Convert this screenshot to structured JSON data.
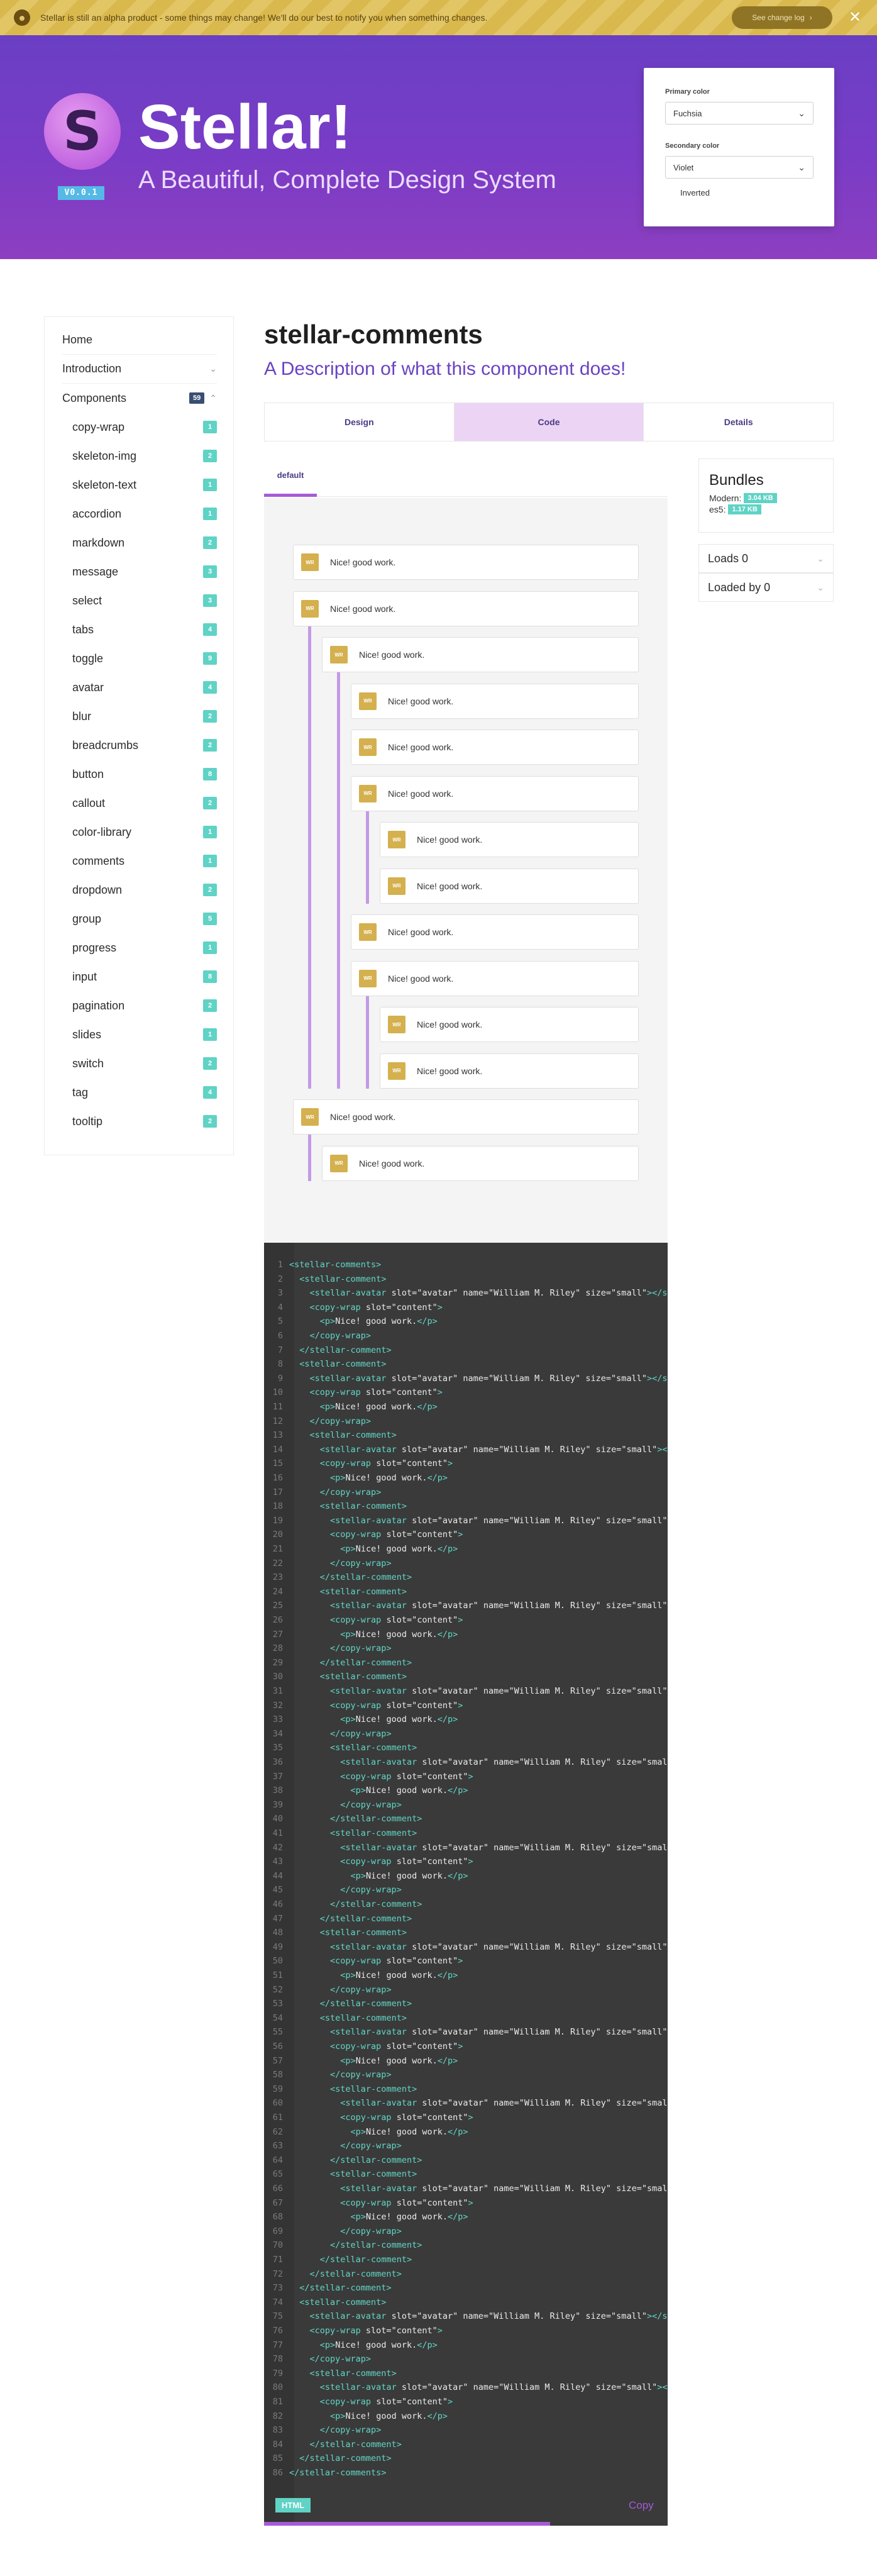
{
  "banner": {
    "logo_glyph": "☻",
    "message": "Stellar is still an alpha product - some things may change! We'll do our best to notify you when something changes.",
    "changelog_label": "See change log",
    "changelog_icon": "chevron-right-icon",
    "close_glyph": "✕"
  },
  "hero": {
    "logo_letter": "S",
    "version": "V0.0.1",
    "title": "Stellar!",
    "subtitle": "A Beautiful, Complete Design System"
  },
  "settings": {
    "primary_label": "Primary color",
    "primary_value": "Fuchsia",
    "secondary_label": "Secondary color",
    "secondary_value": "Violet",
    "inverted_label": "Inverted",
    "inverted_checked": false
  },
  "sidebar": {
    "home": "Home",
    "introduction": "Introduction",
    "components": "Components",
    "components_count": "59",
    "items": [
      {
        "label": "copy-wrap",
        "badge": "1"
      },
      {
        "label": "skeleton-img",
        "badge": "2"
      },
      {
        "label": "skeleton-text",
        "badge": "1"
      },
      {
        "label": "accordion",
        "badge": "1"
      },
      {
        "label": "markdown",
        "badge": "2"
      },
      {
        "label": "message",
        "badge": "3"
      },
      {
        "label": "select",
        "badge": "3"
      },
      {
        "label": "tabs",
        "badge": "4"
      },
      {
        "label": "toggle",
        "badge": "9"
      },
      {
        "label": "avatar",
        "badge": "4"
      },
      {
        "label": "blur",
        "badge": "2"
      },
      {
        "label": "breadcrumbs",
        "badge": "2"
      },
      {
        "label": "button",
        "badge": "8"
      },
      {
        "label": "callout",
        "badge": "2"
      },
      {
        "label": "color-library",
        "badge": "1"
      },
      {
        "label": "comments",
        "badge": "1"
      },
      {
        "label": "dropdown",
        "badge": "2"
      },
      {
        "label": "group",
        "badge": "5"
      },
      {
        "label": "progress",
        "badge": "1"
      },
      {
        "label": "input",
        "badge": "8"
      },
      {
        "label": "pagination",
        "badge": "2"
      },
      {
        "label": "slides",
        "badge": "1"
      },
      {
        "label": "switch",
        "badge": "2"
      },
      {
        "label": "tag",
        "badge": "4"
      },
      {
        "label": "tooltip",
        "badge": "2"
      }
    ]
  },
  "main": {
    "title": "stellar-comments",
    "description": "A Description of what this component does!",
    "tabs": [
      "Design",
      "Code",
      "Details"
    ],
    "active_tab": "Code",
    "subtab": "default",
    "comment_text": "Nice! good work.",
    "avatar_initials": "WR"
  },
  "bundles": {
    "title": "Bundles",
    "modern_label": "Modern:",
    "modern_size": "3.04 KB",
    "es5_label": "es5:",
    "es5_size": "1.17 KB"
  },
  "loads": {
    "loads": "Loads 0",
    "loaded_by": "Loaded by 0"
  },
  "code": {
    "language": "HTML",
    "copy_label": "Copy",
    "lines": [
      "<stellar-comments>",
      "  <stellar-comment>",
      "    <stellar-avatar slot=\"avatar\" name=\"William M. Riley\" size=\"small\"></stellar-avatar>",
      "    <copy-wrap slot=\"content\">",
      "      <p>Nice! good work.</p>",
      "    </copy-wrap>",
      "  </stellar-comment>",
      "  <stellar-comment>",
      "    <stellar-avatar slot=\"avatar\" name=\"William M. Riley\" size=\"small\"></stellar-avatar>",
      "    <copy-wrap slot=\"content\">",
      "      <p>Nice! good work.</p>",
      "    </copy-wrap>",
      "    <stellar-comment>",
      "      <stellar-avatar slot=\"avatar\" name=\"William M. Riley\" size=\"small\"></stellar-avatar>",
      "      <copy-wrap slot=\"content\">",
      "        <p>Nice! good work.</p>",
      "      </copy-wrap>",
      "      <stellar-comment>",
      "        <stellar-avatar slot=\"avatar\" name=\"William M. Riley\" size=\"small\"></stellar-avatar>",
      "        <copy-wrap slot=\"content\">",
      "          <p>Nice! good work.</p>",
      "        </copy-wrap>",
      "      </stellar-comment>",
      "      <stellar-comment>",
      "        <stellar-avatar slot=\"avatar\" name=\"William M. Riley\" size=\"small\"></stellar-avatar>",
      "        <copy-wrap slot=\"content\">",
      "          <p>Nice! good work.</p>",
      "        </copy-wrap>",
      "      </stellar-comment>",
      "      <stellar-comment>",
      "        <stellar-avatar slot=\"avatar\" name=\"William M. Riley\" size=\"small\"></stellar-avatar>",
      "        <copy-wrap slot=\"content\">",
      "          <p>Nice! good work.</p>",
      "        </copy-wrap>",
      "        <stellar-comment>",
      "          <stellar-avatar slot=\"avatar\" name=\"William M. Riley\" size=\"small\"></stellar-avatar>",
      "          <copy-wrap slot=\"content\">",
      "            <p>Nice! good work.</p>",
      "          </copy-wrap>",
      "        </stellar-comment>",
      "        <stellar-comment>",
      "          <stellar-avatar slot=\"avatar\" name=\"William M. Riley\" size=\"small\"></stellar-avatar>",
      "          <copy-wrap slot=\"content\">",
      "            <p>Nice! good work.</p>",
      "          </copy-wrap>",
      "        </stellar-comment>",
      "      </stellar-comment>",
      "      <stellar-comment>",
      "        <stellar-avatar slot=\"avatar\" name=\"William M. Riley\" size=\"small\"></stellar-avatar>",
      "        <copy-wrap slot=\"content\">",
      "          <p>Nice! good work.</p>",
      "        </copy-wrap>",
      "      </stellar-comment>",
      "      <stellar-comment>",
      "        <stellar-avatar slot=\"avatar\" name=\"William M. Riley\" size=\"small\"></stellar-avatar>",
      "        <copy-wrap slot=\"content\">",
      "          <p>Nice! good work.</p>",
      "        </copy-wrap>",
      "        <stellar-comment>",
      "          <stellar-avatar slot=\"avatar\" name=\"William M. Riley\" size=\"small\"></stellar-avatar>",
      "          <copy-wrap slot=\"content\">",
      "            <p>Nice! good work.</p>",
      "          </copy-wrap>",
      "        </stellar-comment>",
      "        <stellar-comment>",
      "          <stellar-avatar slot=\"avatar\" name=\"William M. Riley\" size=\"small\"></stellar-avatar>",
      "          <copy-wrap slot=\"content\">",
      "            <p>Nice! good work.</p>",
      "          </copy-wrap>",
      "        </stellar-comment>",
      "      </stellar-comment>",
      "    </stellar-comment>",
      "  </stellar-comment>",
      "  <stellar-comment>",
      "    <stellar-avatar slot=\"avatar\" name=\"William M. Riley\" size=\"small\"></stellar-avatar>",
      "    <copy-wrap slot=\"content\">",
      "      <p>Nice! good work.</p>",
      "    </copy-wrap>",
      "    <stellar-comment>",
      "      <stellar-avatar slot=\"avatar\" name=\"William M. Riley\" size=\"small\"></stellar-avatar>",
      "      <copy-wrap slot=\"content\">",
      "        <p>Nice! good work.</p>",
      "      </copy-wrap>",
      "    </stellar-comment>",
      "  </stellar-comment>",
      "</stellar-comments>"
    ]
  },
  "colors": {
    "accent": "#a65ad8",
    "brand_purple": "#6a3fc4",
    "badge": "#5fd3c5",
    "avatar": "#d4b04e"
  }
}
